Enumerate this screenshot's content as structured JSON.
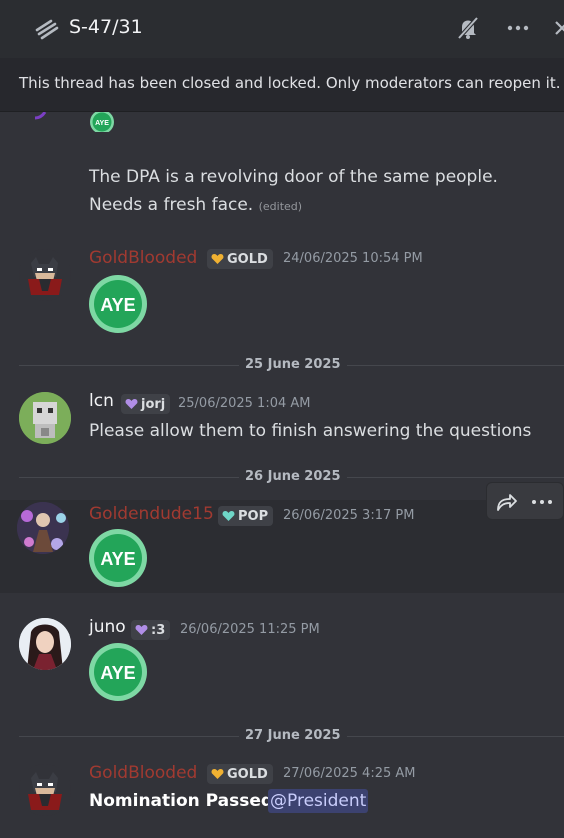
{
  "header": {
    "title": "S-47/31"
  },
  "banner": {
    "text": "This thread has been closed and locked. Only moderators can reopen it."
  },
  "messages": [
    {
      "text_line1": "The DPA is a revolving door of the same people.",
      "text_line2": "Needs a fresh face.",
      "edited": "(edited)"
    },
    {
      "username": "GoldBlooded",
      "tag": "GOLD",
      "timestamp": "24/06/2025 10:54 PM",
      "sticker": "AYE"
    },
    {
      "username": "lcn",
      "tag": "jorj",
      "timestamp": "25/06/2025 1:04 AM",
      "text": "Please allow them to finish answering the questions"
    },
    {
      "username": "Goldendude15",
      "tag": "POP",
      "timestamp": "26/06/2025 3:17 PM",
      "sticker": "AYE"
    },
    {
      "username": "juno",
      "tag": ":3",
      "timestamp": "26/06/2025 11:25 PM",
      "sticker": "AYE"
    },
    {
      "username": "GoldBlooded",
      "tag": "GOLD",
      "timestamp": "27/06/2025 4:25 AM",
      "text_bold": "Nomination Passed.",
      "mention": "@President"
    }
  ],
  "dividers": [
    "25 June 2025",
    "26 June 2025",
    "27 June 2025"
  ],
  "stickers": {
    "small_label": "AYE"
  },
  "colors": {
    "background": "#323339",
    "header": "#2b2d31",
    "username_red": "#a13a31",
    "aye_green": "#23a559",
    "tag_gold_heart": "#f0b132",
    "tag_teal_heart": "#6fd6c7",
    "tag_purple_heart": "#b08ee6",
    "mention_bg": "#3c4270"
  }
}
